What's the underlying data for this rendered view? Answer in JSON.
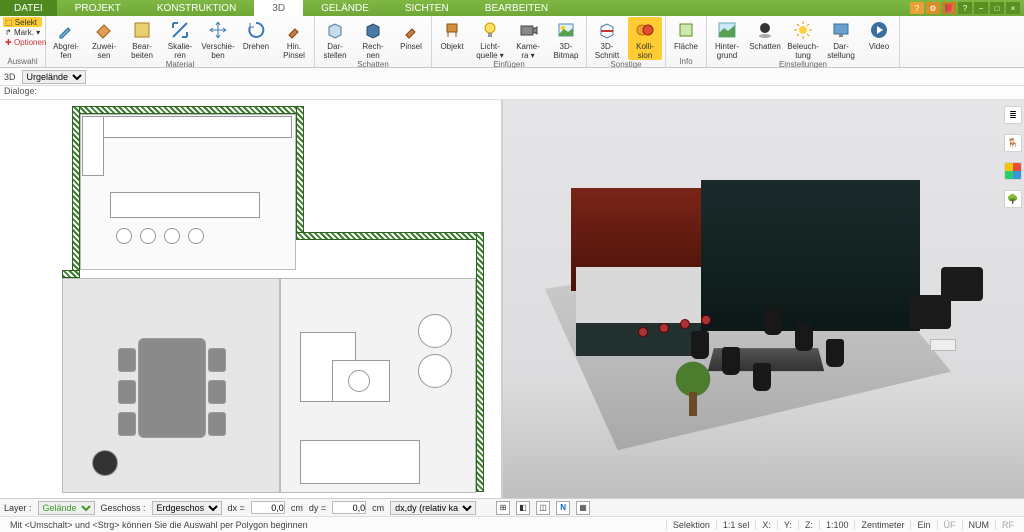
{
  "menu": {
    "tabs": [
      "DATEI",
      "PROJEKT",
      "KONSTRUKTION",
      "3D",
      "GELÄNDE",
      "SICHTEN",
      "BEARBEITEN"
    ],
    "active_index": 3
  },
  "ribbon": {
    "groups": [
      {
        "title": "Auswahl",
        "buttons": [
          {
            "id": "selekt",
            "label": "Selekt",
            "hl": false
          },
          {
            "id": "mark",
            "label": "Mark.",
            "hl": false
          },
          {
            "id": "optionen",
            "label": "Optionen",
            "hl": false
          }
        ],
        "small": true
      },
      {
        "title": "Material",
        "buttons": [
          {
            "id": "abgreifen",
            "label": "Abgrei-\nfen"
          },
          {
            "id": "zuweisen",
            "label": "Zuwei-\nsen"
          },
          {
            "id": "bearbeiten",
            "label": "Bear-\nbeiten"
          },
          {
            "id": "skalieren",
            "label": "Skalie-\nren"
          },
          {
            "id": "verschieben",
            "label": "Verschie-\nben"
          },
          {
            "id": "drehen",
            "label": "Drehen"
          },
          {
            "id": "hinpinsel",
            "label": "Hin.\nPinsel"
          }
        ]
      },
      {
        "title": "Schatten",
        "buttons": [
          {
            "id": "darstellen",
            "label": "Dar-\nstellen"
          },
          {
            "id": "rechnen",
            "label": "Rech-\nnen"
          },
          {
            "id": "pinsel",
            "label": "Pinsel"
          }
        ]
      },
      {
        "title": "Einfügen",
        "buttons": [
          {
            "id": "objekt",
            "label": "Objekt"
          },
          {
            "id": "lichtquelle",
            "label": "Licht-\nquelle ▾"
          },
          {
            "id": "kamera",
            "label": "Kame-\nra ▾"
          },
          {
            "id": "bitmap3d",
            "label": "3D-\nBitmap"
          }
        ]
      },
      {
        "title": "Sonstige",
        "buttons": [
          {
            "id": "schnitt3d",
            "label": "3D-\nSchnitt"
          },
          {
            "id": "kollision",
            "label": "Kolli-\nsion",
            "hl": true
          }
        ]
      },
      {
        "title": "Info",
        "buttons": [
          {
            "id": "flaeche",
            "label": "Fläche"
          }
        ]
      },
      {
        "title": "Einstellungen",
        "buttons": [
          {
            "id": "hintergrund",
            "label": "Hinter-\ngrund"
          },
          {
            "id": "schatten2",
            "label": "Schatten"
          },
          {
            "id": "beleuchtung",
            "label": "Beleuch-\ntung"
          },
          {
            "id": "darstellung",
            "label": "Dar-\nstellung"
          },
          {
            "id": "video",
            "label": "Video"
          }
        ]
      }
    ]
  },
  "mini": {
    "label3d": "3D",
    "dropdown": "Urgelände"
  },
  "dlg": {
    "label": "Dialoge:"
  },
  "bottom": {
    "layer_lbl": "Layer :",
    "layer_val": "Gelände",
    "geschoss_lbl": "Geschoss :",
    "geschoss_val": "Erdgeschos",
    "dx_lbl": "dx =",
    "dx_val": "0,0",
    "cm1": "cm",
    "dy_lbl": "dy =",
    "dy_val": "0,0",
    "cm2": "cm",
    "mode": "dx,dy (relativ ka"
  },
  "status": {
    "hint": "Mit <Umschalt> und <Strg> können Sie die Auswahl per Polygon beginnen",
    "sel": "Selektion",
    "scale": "1:1 sel",
    "x": "X:",
    "y": "Y:",
    "z": "Z:",
    "scale2": "1:100",
    "unit": "Zentimeter",
    "ein": "Ein",
    "uf": "ÜF",
    "num": "NUM",
    "rf": "RF"
  },
  "rtools": [
    "layers",
    "chair",
    "colors",
    "tree"
  ]
}
